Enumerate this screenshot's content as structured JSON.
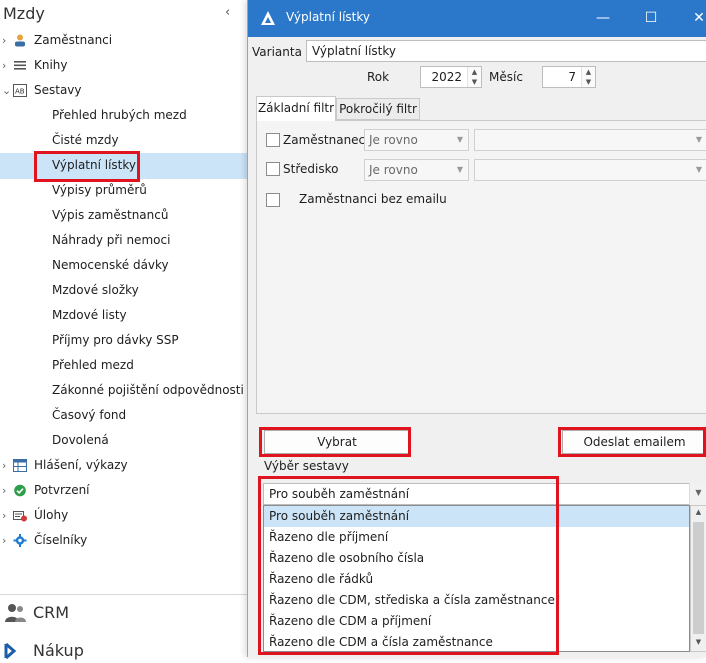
{
  "nav": {
    "title": "Mzdy",
    "collapse_icon": "chevron-left-icon",
    "groups": [
      {
        "label": "Zaměstnanci",
        "icon": "person-icon",
        "expanded": false
      },
      {
        "label": "Knihy",
        "icon": "list-icon",
        "expanded": false
      },
      {
        "label": "Sestavy",
        "icon": "report-icon",
        "expanded": true
      }
    ],
    "sestavy_items": [
      "Přehled hrubých mezd",
      "Čisté mzdy",
      "Výplatní lístky",
      "Výpisy průměrů",
      "Výpis zaměstnanců",
      "Náhrady při nemoci",
      "Nemocenské dávky",
      "Mzdové složky",
      "Mzdové listy",
      "Příjmy pro dávky SSP",
      "Přehled mezd",
      "Zákonné pojištění odpovědnosti",
      "Časový fond",
      "Dovolená"
    ],
    "selected_item": "Výplatní lístky",
    "more_groups": [
      {
        "label": "Hlášení, výkazy",
        "icon": "table-icon"
      },
      {
        "label": "Potvrzení",
        "icon": "check-circle-icon"
      },
      {
        "label": "Úlohy",
        "icon": "task-icon"
      },
      {
        "label": "Číselníky",
        "icon": "gear-icon"
      }
    ],
    "modules": [
      {
        "label": "CRM",
        "icon": "people-icon"
      },
      {
        "label": "Nákup",
        "icon": "purchase-icon"
      }
    ]
  },
  "dialog": {
    "title": "Výplatní lístky",
    "window_buttons": [
      "minimize-icon",
      "maximize-icon",
      "close-icon"
    ],
    "varianta_label": "Varianta",
    "varianta_value": "Výplatní lístky",
    "rok_label": "Rok",
    "rok_value": "2022",
    "mesic_label": "Měsíc",
    "mesic_value": "7",
    "tabs": [
      "Základní filtr",
      "Pokročilý filtr"
    ],
    "active_tab": "Základní filtr",
    "filters": [
      {
        "label": "Zaměstnanec",
        "operator": "Je rovno",
        "checked": false
      },
      {
        "label": "Středisko",
        "operator": "Je rovno",
        "checked": false
      }
    ],
    "email_filter_label": "Zaměstnanci bez emailu",
    "vybrat_button": "Vybrat",
    "send_button": "Odeslat emailem",
    "report_select_label": "Výběr sestavy",
    "report_selected": "Pro souběh zaměstnání",
    "report_options": [
      "Pro souběh zaměstnání",
      "Řazeno dle příjmení",
      "Řazeno dle osobního čísla",
      "Řazeno dle řádků",
      "Řazeno dle CDM, střediska a čísla zaměstnance",
      "Řazeno dle CDM a příjmení",
      "Řazeno dle CDM a čísla zaměstnance"
    ]
  },
  "colors": {
    "titlebar": "#2b78cb",
    "selection": "#cce4f7",
    "highlight_red": "#e0141e"
  }
}
